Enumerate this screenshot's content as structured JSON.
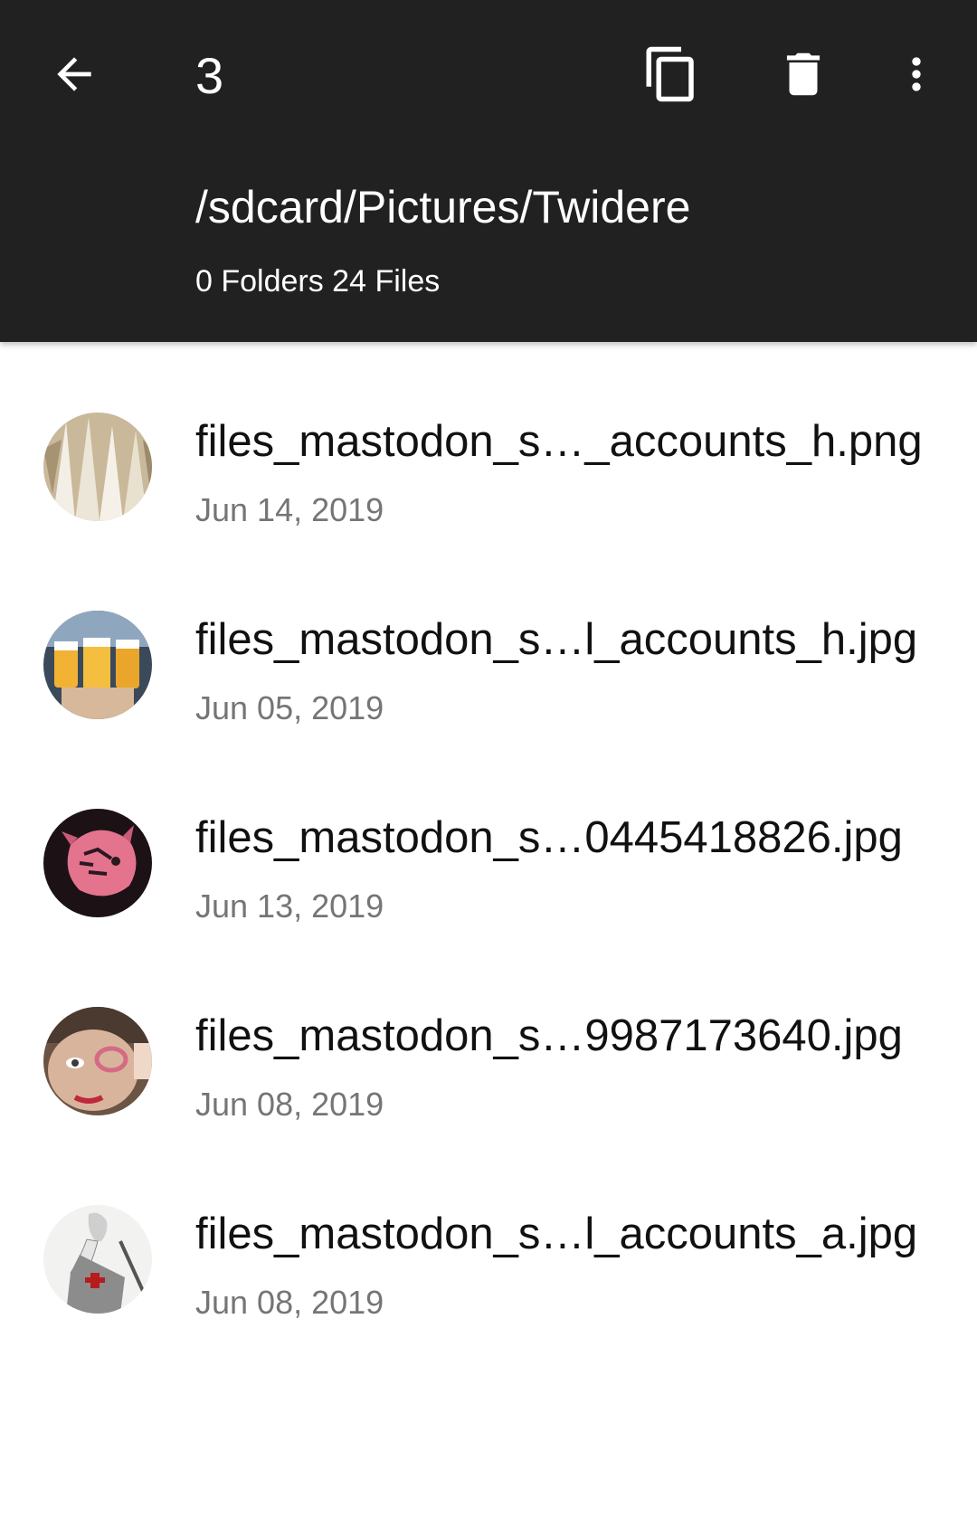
{
  "appbar": {
    "selected_count": "3",
    "path": "/sdcard/Pictures/Twidere",
    "summary": "0 Folders 24 Files",
    "icons": {
      "back": "arrow-back-icon",
      "copy": "copy-icon",
      "delete": "delete-icon",
      "more": "more-vert-icon"
    }
  },
  "files": [
    {
      "name": "files_mastodon_s…_accounts_h.png",
      "date": "Jun 14, 2019",
      "thumb": "feathers-thumbnail"
    },
    {
      "name": "files_mastodon_s…l_accounts_h.jpg",
      "date": "Jun 05, 2019",
      "thumb": "beer-glasses-thumbnail"
    },
    {
      "name": "files_mastodon_s…0445418826.jpg",
      "date": "Jun 13, 2019",
      "thumb": "pink-boar-thumbnail"
    },
    {
      "name": "files_mastodon_s…9987173640.jpg",
      "date": "Jun 08, 2019",
      "thumb": "face-glasses-thumbnail"
    },
    {
      "name": "files_mastodon_s…l_accounts_a.jpg",
      "date": "Jun 08, 2019",
      "thumb": "knight-drawing-thumbnail"
    }
  ],
  "colors": {
    "appbar_bg": "#212121",
    "on_appbar": "#ffffff",
    "primary_text": "#111111",
    "secondary_text": "#757575"
  }
}
